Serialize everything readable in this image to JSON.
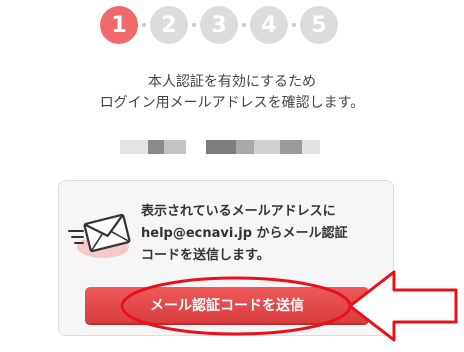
{
  "stepper": {
    "steps": [
      "1",
      "2",
      "3",
      "4",
      "5"
    ],
    "active_index": 0
  },
  "intro": {
    "line1": "本人認証を有効にするため",
    "line2": "ログイン用メールアドレスを確認します。"
  },
  "card": {
    "line1": "表示されているメールアドレスに",
    "line2": "help@ecnavi.jp からメール認証",
    "line3": "コードを送信します。",
    "icon": "envelope-icon"
  },
  "send_button": {
    "label": "メール認証コードを送信"
  },
  "annotations": {
    "highlight": "red-ellipse",
    "pointer": "red-arrow-left"
  },
  "colors": {
    "accent": "#ef6a6a",
    "step_inactive": "#dcdcdc",
    "button": "#e04848",
    "annotation": "#e8101a"
  }
}
